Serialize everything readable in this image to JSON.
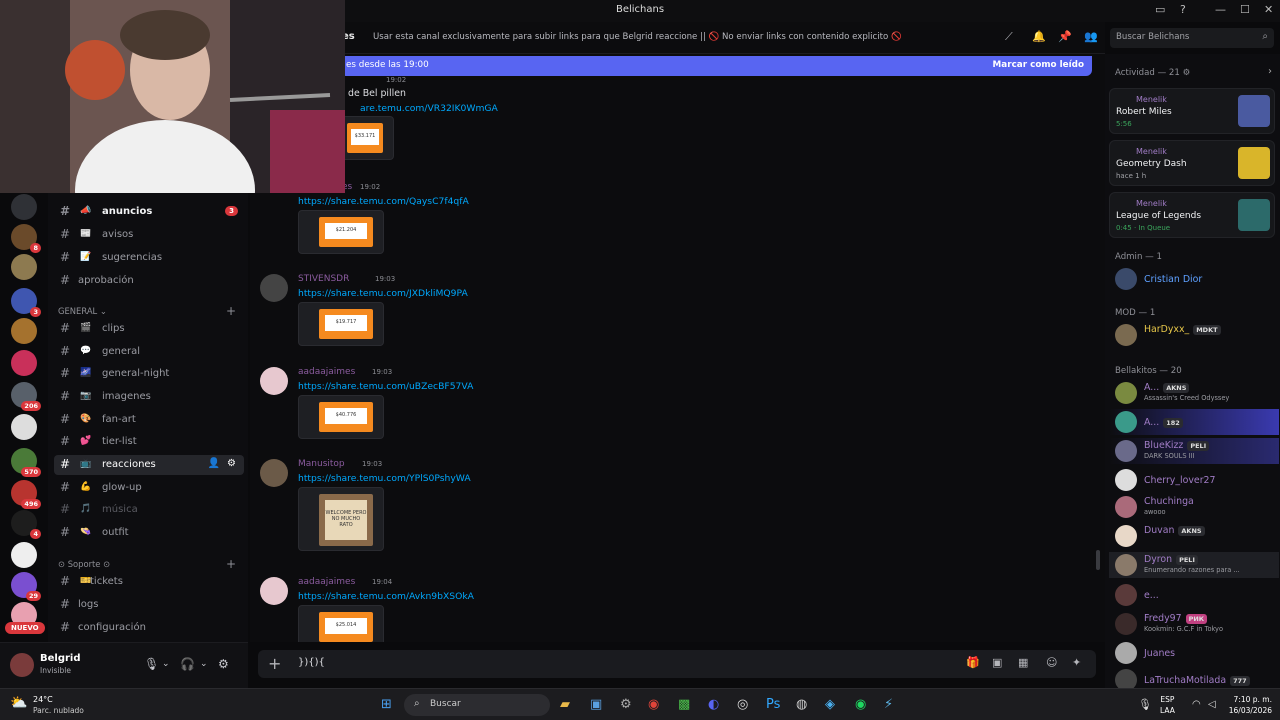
{
  "window": {
    "title": "Belichans"
  },
  "header": {
    "channel": "es",
    "topic": "Usar esta canal exclusivamente para subir links para que Belgrid reaccione || 🚫 No enviar links con contenido explicito 🚫",
    "search_placeholder": "Buscar Belichans"
  },
  "new_messages_bar": {
    "text": "es desde las 19:00",
    "action": "Marcar como leído"
  },
  "channels": {
    "items": [
      {
        "emoji": "📣",
        "name": "anuncios",
        "badge": "3",
        "state": "bold"
      },
      {
        "emoji": "📰",
        "name": "avisos",
        "state": ""
      },
      {
        "emoji": "📝",
        "name": "sugerencias",
        "state": ""
      },
      {
        "emoji": "",
        "name": "aprobación",
        "state": ""
      }
    ],
    "category_general": "GENERAL",
    "general_items": [
      {
        "emoji": "🎬",
        "name": "clips",
        "state": ""
      },
      {
        "emoji": "💬",
        "name": "general",
        "state": ""
      },
      {
        "emoji": "🌌",
        "name": "general-night",
        "state": ""
      },
      {
        "emoji": "📷",
        "name": "imagenes",
        "state": ""
      },
      {
        "emoji": "🎨",
        "name": "fan-art",
        "state": ""
      },
      {
        "emoji": "💕",
        "name": "tier-list",
        "state": ""
      },
      {
        "emoji": "📺",
        "name": "reacciones",
        "state": "active"
      },
      {
        "emoji": "💪",
        "name": "glow-up",
        "state": ""
      },
      {
        "emoji": "🎵",
        "name": "música",
        "state": "muted"
      },
      {
        "emoji": "👒",
        "name": "outfit",
        "state": ""
      }
    ],
    "category_soporte": "Soporte",
    "soporte_items": [
      {
        "emoji": "🎫",
        "name": "tickets",
        "state": ""
      },
      {
        "emoji": "",
        "name": "logs",
        "state": ""
      },
      {
        "emoji": "",
        "name": "configuración",
        "state": ""
      }
    ]
  },
  "servers": {
    "badges": [
      "8",
      "3",
      "206",
      "570",
      "496",
      "4",
      "29"
    ],
    "new_label": "NUEVO"
  },
  "user": {
    "name": "Belgrid",
    "status": "Invisible"
  },
  "messages": [
    {
      "author": "",
      "time": "19:02",
      "text": "de Bel pillen",
      "link": "are.temu.com/VR32IK0WmGA",
      "price": "$33.171",
      "color": "#a5a6ab"
    },
    {
      "author": "es",
      "time": "19:02",
      "link": "https://share.temu.com/QaysC7f4qfA",
      "price": "$21.204",
      "color": "#8a5b9e"
    },
    {
      "author": "STIVENSDR",
      "time": "19:03",
      "link": "https://share.temu.com/JXDkliMQ9PA",
      "price": "$19.717",
      "color": "#8a5b9e"
    },
    {
      "author": "aadaajaimes",
      "time": "19:03",
      "link": "https://share.temu.com/uBZecBF57VA",
      "price": "$40.776",
      "color": "#8a5b9e"
    },
    {
      "author": "Manusitop",
      "time": "19:03",
      "link": "https://share.temu.com/YPlS0PshyWA",
      "price": "WELCOME PERO NO MUCHO RATO",
      "color": "#8a5b9e"
    },
    {
      "author": "aadaajaimes",
      "time": "19:04",
      "link": "https://share.temu.com/Avkn9bXSOkA",
      "price": "$25.014",
      "color": "#8a5b9e"
    }
  ],
  "composer": {
    "text": "}){){"
  },
  "members": {
    "activity_header": "Actividad — 21",
    "activities": [
      {
        "who": "Menelik",
        "title": "Robert Miles",
        "status": "5:56"
      },
      {
        "who": "Menelik",
        "title": "Geometry Dash",
        "status": "hace 1 h"
      },
      {
        "who": "Menelik",
        "title": "League of Legends",
        "status": "0:45 · In Queue"
      }
    ],
    "admin_header": "Admin — 1",
    "admin": [
      {
        "name": "Cristian Dior",
        "status": "",
        "tag": ""
      }
    ],
    "mod_header": "MOD — 1",
    "mod": [
      {
        "name": "HarDyxx_",
        "status": "",
        "tag": "MDKT"
      }
    ],
    "bella_header": "Bellakitos — 20",
    "bella": [
      {
        "name": "A...",
        "status": "Assassin's Creed Odyssey",
        "tag": "AKNS"
      },
      {
        "name": "A...",
        "status": "",
        "tag": "182"
      },
      {
        "name": "BlueKizz",
        "status": "DARK SOULS III",
        "tag": "PELI"
      },
      {
        "name": "Cherry_lover27",
        "status": "",
        "tag": ""
      },
      {
        "name": "Chuchinga",
        "status": "awooo",
        "tag": ""
      },
      {
        "name": "Duvan",
        "status": "",
        "tag": "AKNS"
      },
      {
        "name": "Dyron",
        "status": "Enumerando razones para ...",
        "tag": "PELI"
      },
      {
        "name": "e...",
        "status": "",
        "tag": ""
      },
      {
        "name": "Fredy97",
        "status": "Kookmin: G.C.F in Tokyo",
        "tag": "РИК"
      },
      {
        "name": "Juanes",
        "status": "",
        "tag": ""
      },
      {
        "name": "LaTruchaMotilada",
        "status": "",
        "tag": "777"
      }
    ]
  },
  "taskbar": {
    "weather_temp": "24°C",
    "weather_desc": "Parc. nublado",
    "search": "Buscar",
    "lang1": "ESP",
    "lang2": "LAA",
    "time": "7:10 p. m.",
    "date": "16/03/2026"
  },
  "colors": {
    "accent": "#5865f2",
    "link": "#00a8fc",
    "badge": "#da373c"
  }
}
